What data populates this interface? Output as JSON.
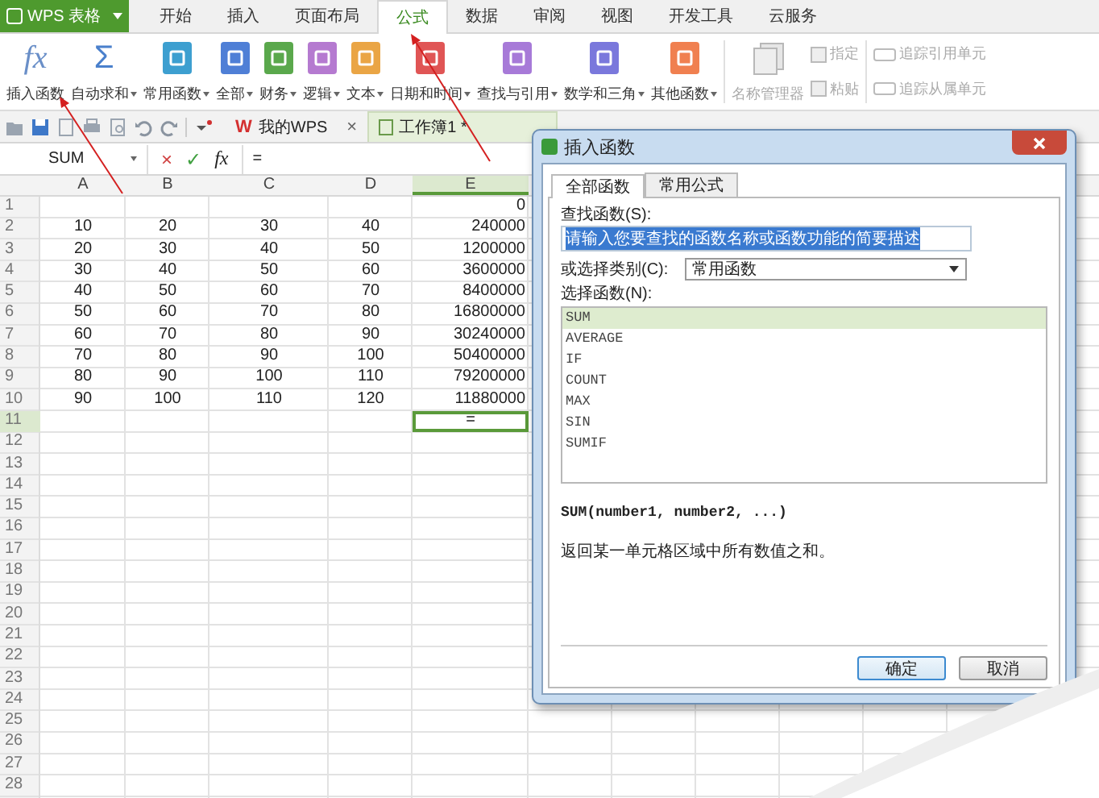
{
  "app_button": {
    "label": "WPS 表格"
  },
  "menu_tabs": [
    {
      "label": "开始",
      "selected": false
    },
    {
      "label": "插入",
      "selected": false
    },
    {
      "label": "页面布局",
      "selected": false
    },
    {
      "label": "公式",
      "selected": true
    },
    {
      "label": "数据",
      "selected": false
    },
    {
      "label": "审阅",
      "selected": false
    },
    {
      "label": "视图",
      "selected": false
    },
    {
      "label": "开发工具",
      "selected": false
    },
    {
      "label": "云服务",
      "selected": false
    }
  ],
  "ribbon": [
    {
      "label": "插入函数",
      "kind": "glyph",
      "glyph": "fx",
      "dropdown": false,
      "disabled": false
    },
    {
      "label": "自动求和",
      "kind": "glyph",
      "glyph": "Σ",
      "dropdown": true,
      "disabled": false
    },
    {
      "label": "常用函数",
      "kind": "tile",
      "color": "#3d9fd0",
      "dropdown": true,
      "disabled": false
    },
    {
      "label": "全部",
      "kind": "tile",
      "color": "#4f7fd6",
      "dropdown": true,
      "disabled": false
    },
    {
      "label": "财务",
      "kind": "tile",
      "color": "#5aa84c",
      "dropdown": true,
      "disabled": false
    },
    {
      "label": "逻辑",
      "kind": "tile",
      "color": "#b57ad0",
      "dropdown": true,
      "disabled": false
    },
    {
      "label": "文本",
      "kind": "tile",
      "color": "#eaa545",
      "dropdown": true,
      "disabled": false
    },
    {
      "label": "日期和时间",
      "kind": "tile",
      "color": "#e05555",
      "dropdown": true,
      "disabled": false
    },
    {
      "label": "查找与引用",
      "kind": "tile",
      "color": "#a77ad8",
      "dropdown": true,
      "disabled": false
    },
    {
      "label": "数学和三角",
      "kind": "tile",
      "color": "#7a78dc",
      "dropdown": true,
      "disabled": false
    },
    {
      "label": "其他函数",
      "kind": "tile",
      "color": "#f08050",
      "dropdown": true,
      "disabled": false
    },
    {
      "label": "名称管理器",
      "kind": "stack",
      "dropdown": false,
      "disabled": true
    }
  ],
  "ribbon_small": [
    {
      "label": "指定",
      "disabled": true
    },
    {
      "label": "粘贴",
      "disabled": true
    }
  ],
  "ribbon_trace": [
    {
      "label": "追踪引用单元",
      "disabled": true
    },
    {
      "label": "追踪从属单元",
      "disabled": true
    }
  ],
  "doc_tabs": [
    {
      "label": "我的WPS",
      "logo": "W",
      "close": "×",
      "selected": false
    },
    {
      "label": "工作簿1 *",
      "selected": true
    }
  ],
  "formula_bar": {
    "name_box": "SUM",
    "cancel": "×",
    "enter": "✓",
    "fx": "fx",
    "value": "="
  },
  "sheet": {
    "columns": [
      {
        "label": "A",
        "selected": false
      },
      {
        "label": "B",
        "selected": false
      },
      {
        "label": "C",
        "selected": false
      },
      {
        "label": "D",
        "selected": false
      },
      {
        "label": "E",
        "selected": true
      }
    ],
    "rows": [
      {
        "number": "1",
        "active": false,
        "cells": [
          null,
          null,
          null,
          null,
          "0"
        ]
      },
      {
        "number": "2",
        "active": false,
        "cells": [
          "10",
          "20",
          "30",
          "40",
          "240000"
        ]
      },
      {
        "number": "3",
        "active": false,
        "cells": [
          "20",
          "30",
          "40",
          "50",
          "1200000"
        ]
      },
      {
        "number": "4",
        "active": false,
        "cells": [
          "30",
          "40",
          "50",
          "60",
          "3600000"
        ]
      },
      {
        "number": "5",
        "active": false,
        "cells": [
          "40",
          "50",
          "60",
          "70",
          "8400000"
        ]
      },
      {
        "number": "6",
        "active": false,
        "cells": [
          "50",
          "60",
          "70",
          "80",
          "16800000"
        ]
      },
      {
        "number": "7",
        "active": false,
        "cells": [
          "60",
          "70",
          "80",
          "90",
          "30240000"
        ]
      },
      {
        "number": "8",
        "active": false,
        "cells": [
          "70",
          "80",
          "90",
          "100",
          "50400000"
        ]
      },
      {
        "number": "9",
        "active": false,
        "cells": [
          "80",
          "90",
          "100",
          "110",
          "79200000"
        ]
      },
      {
        "number": "10",
        "active": false,
        "cells": [
          "90",
          "100",
          "110",
          "120",
          "11880000"
        ]
      },
      {
        "number": "11",
        "active": true,
        "cells": [
          null,
          null,
          null,
          null,
          "="
        ]
      },
      {
        "number": "12",
        "active": false
      },
      {
        "number": "13",
        "active": false
      },
      {
        "number": "14",
        "active": false
      },
      {
        "number": "15",
        "active": false
      },
      {
        "number": "16",
        "active": false
      },
      {
        "number": "17",
        "active": false
      },
      {
        "number": "18",
        "active": false
      },
      {
        "number": "19",
        "active": false
      },
      {
        "number": "20",
        "active": false
      },
      {
        "number": "21",
        "active": false
      },
      {
        "number": "22",
        "active": false
      },
      {
        "number": "23",
        "active": false
      },
      {
        "number": "24",
        "active": false
      },
      {
        "number": "25",
        "active": false
      },
      {
        "number": "26",
        "active": false
      },
      {
        "number": "27",
        "active": false
      },
      {
        "number": "28",
        "active": false
      }
    ]
  },
  "dialog": {
    "title": "插入函数",
    "tabs": [
      {
        "label": "全部函数",
        "selected": true
      },
      {
        "label": "常用公式",
        "selected": false
      }
    ],
    "search_label": "查找函数(S):",
    "search_value": "请输入您要查找的函数名称或函数功能的简要描述",
    "category_label": "或选择类别(C):",
    "category_value": "常用函数",
    "function_label": "选择函数(N):",
    "functions": [
      {
        "name": "SUM",
        "selected": true
      },
      {
        "name": "AVERAGE",
        "selected": false
      },
      {
        "name": "IF",
        "selected": false
      },
      {
        "name": "COUNT",
        "selected": false
      },
      {
        "name": "MAX",
        "selected": false
      },
      {
        "name": "SIN",
        "selected": false
      },
      {
        "name": "SUMIF",
        "selected": false
      }
    ],
    "signature": "SUM(number1, number2, ...)",
    "description": "返回某一单元格区域中所有数值之和。",
    "buttons": [
      {
        "label": "确定",
        "default": true
      },
      {
        "label": "取消",
        "default": false
      }
    ]
  }
}
